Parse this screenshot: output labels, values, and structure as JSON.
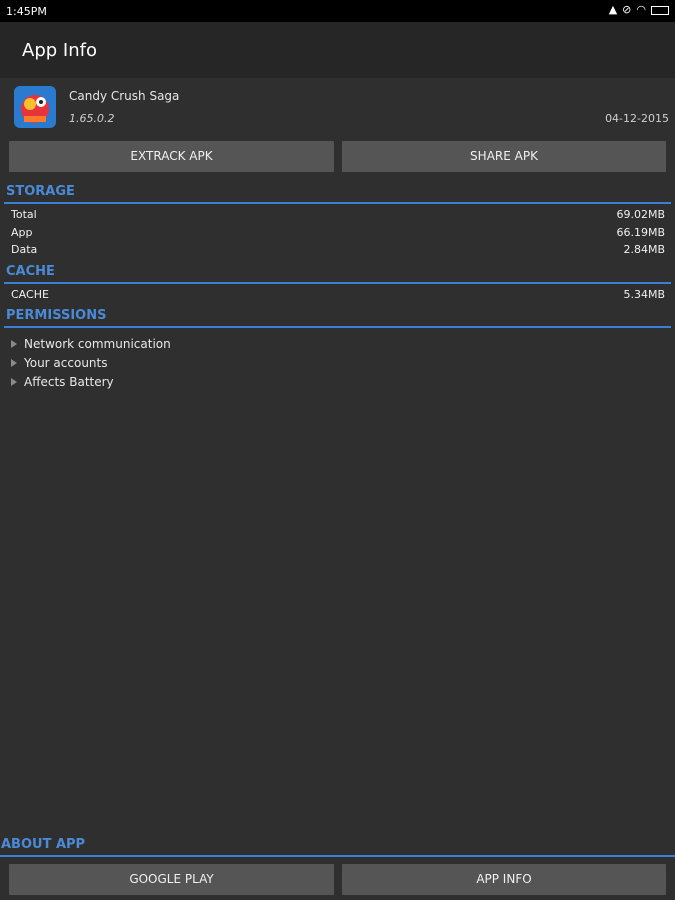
{
  "status_bar": {
    "time": "1:45PM"
  },
  "action_bar": {
    "title": "App Info"
  },
  "app": {
    "name": "Candy Crush Saga",
    "version": "1.65.0.2",
    "date": "04-12-2015",
    "extract_label": "EXTRACK APK",
    "share_label": "SHARE APK"
  },
  "storage": {
    "title": "STORAGE",
    "rows": [
      {
        "label": "Total",
        "value": "69.02MB"
      },
      {
        "label": "App",
        "value": "66.19MB"
      },
      {
        "label": "Data",
        "value": "2.84MB"
      }
    ]
  },
  "cache": {
    "title": "CACHE",
    "rows": [
      {
        "label": "CACHE",
        "value": "5.34MB"
      }
    ]
  },
  "permissions": {
    "title": "PERMISSIONS",
    "items": [
      "Network communication",
      "Your accounts",
      "Affects Battery"
    ]
  },
  "about": {
    "title": "ABOUT APP",
    "google_play_label": "GOOGLE PLAY",
    "app_info_label": "APP INFO"
  },
  "colors": {
    "accent": "#3b7fd8",
    "background": "#2f2f2f",
    "button": "#555555"
  }
}
